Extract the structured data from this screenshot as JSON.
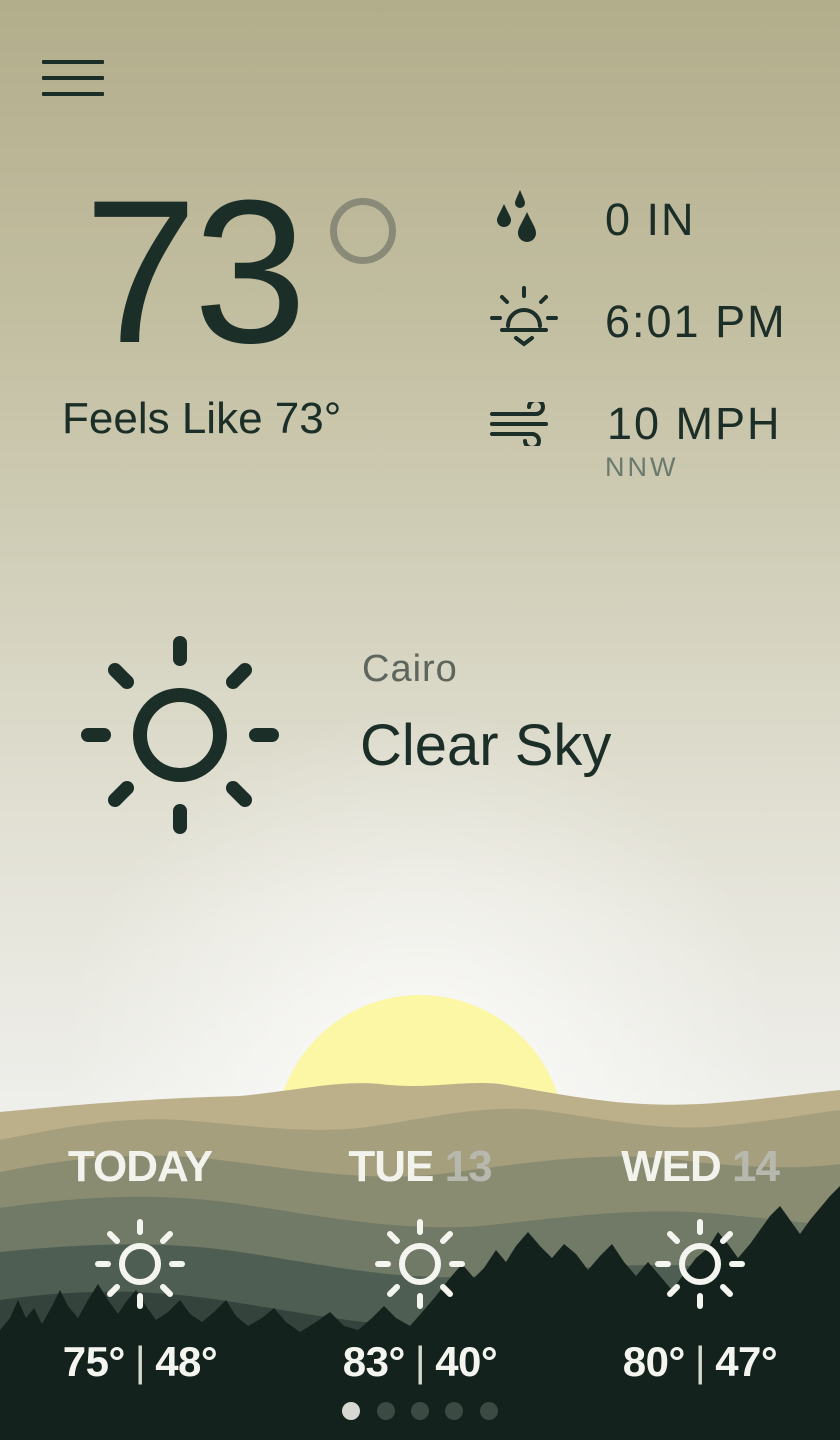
{
  "current": {
    "temperature": "73",
    "feels_like": "Feels Like 73°",
    "precipitation": "0 IN",
    "sunset": "6:01 PM",
    "wind_speed": "10 MPH",
    "wind_direction": "NNW",
    "icons": {
      "precipitation": "raindrops-icon",
      "sunset": "sunset-icon",
      "wind": "wind-icon"
    }
  },
  "location": {
    "city": "Cairo",
    "condition": "Clear Sky",
    "condition_icon": "sun-icon"
  },
  "forecast": [
    {
      "day": "TODAY",
      "date": "",
      "icon": "sun-icon",
      "high": "75°",
      "low": "48°"
    },
    {
      "day": "TUE",
      "date": "13",
      "icon": "sun-icon",
      "high": "83°",
      "low": "40°"
    },
    {
      "day": "WED",
      "date": "14",
      "icon": "sun-icon",
      "high": "80°",
      "low": "47°"
    }
  ],
  "pagination": {
    "count": 5,
    "active_index": 0
  },
  "colors": {
    "text_dark": "#1c2e28",
    "sun_glow": "#fbf7a4",
    "forest": "#14221e"
  }
}
